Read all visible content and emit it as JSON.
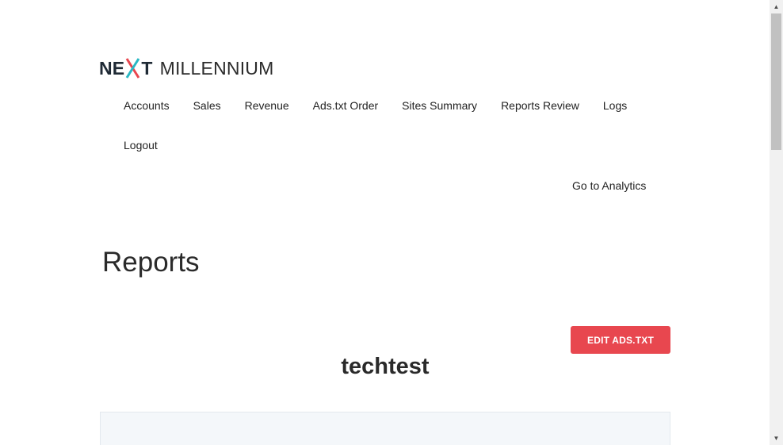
{
  "brand": {
    "logo_next_prefix": "NE",
    "logo_next_suffix": "T",
    "logo_name": "MILLENNIUM",
    "accent_teal": "#29b8c4",
    "accent_red": "#e8474f"
  },
  "nav": {
    "row1": [
      "Accounts",
      "Sales",
      "Revenue",
      "Ads.txt Order",
      "Sites Summary",
      "Reports Review",
      "Logs"
    ],
    "row2": [
      "Logout"
    ],
    "analytics_link": "Go to Analytics"
  },
  "main": {
    "title": "Reports",
    "edit_button": "EDIT ADS.TXT",
    "site_name": "techtest"
  },
  "colors": {
    "button_bg": "#e8474f",
    "panel_bg": "#f4f7fa",
    "text": "#222222"
  },
  "scrollbar": {
    "up_icon": "triangle-up-icon",
    "down_icon": "triangle-down-icon"
  }
}
